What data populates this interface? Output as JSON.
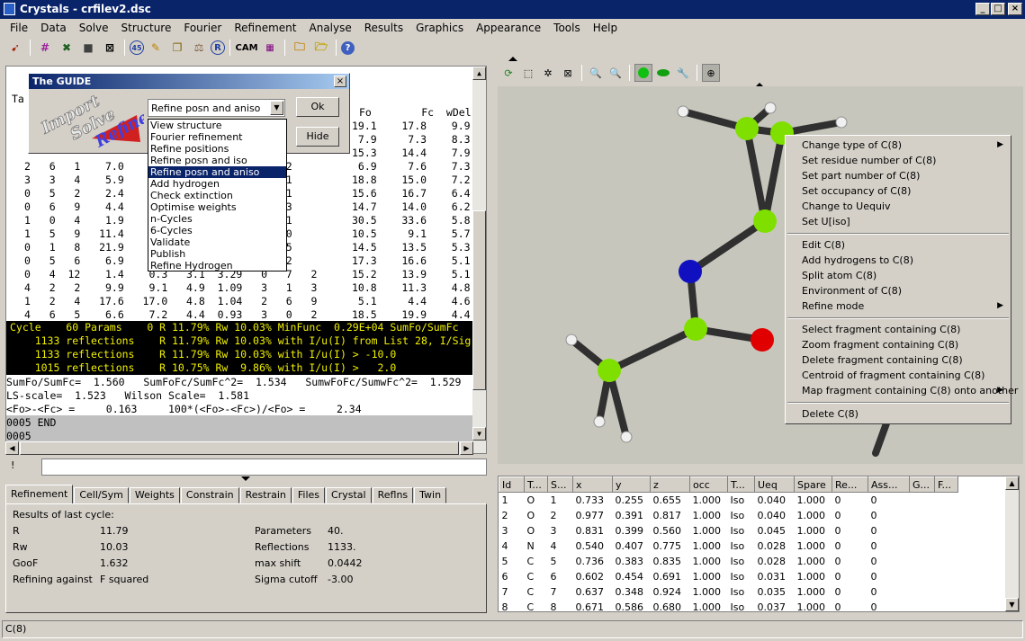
{
  "window": {
    "title": "Crystals - crfilev2.dsc"
  },
  "menu": [
    "File",
    "Data",
    "Solve",
    "Structure",
    "Fourier",
    "Refinement",
    "Analyse",
    "Results",
    "Graphics",
    "Appearance",
    "Tools",
    "Help"
  ],
  "toolbar": {
    "cam_label": "CAM",
    "r_label": "R",
    "n45_label": "45"
  },
  "output": {
    "partial_header": "Ta",
    "header_cols": "Fo        Fc  wDel  F",
    "rows_right": [
      "19.1    17.8    9.9",
      " 7.9     7.3    8.3",
      "15.3    14.4    7.9",
      " 6.9     7.6    7.3",
      "18.8    15.0    7.2",
      "15.6    16.7    6.4",
      "14.7    14.0    6.2",
      "30.5    33.6    5.8",
      "10.5     9.1    5.7",
      "14.5    13.5    5.3",
      "17.3    16.6    5.1",
      "15.2    13.9    5.1",
      "10.8    11.3    4.8",
      " 5.1     4.4    4.6",
      "18.5    19.9    4.4"
    ],
    "rows_full": [
      "2   6   1    7.0                      3  12",
      "3   3   4    5.9                      4   1",
      "0   5   2    2.4                      4   1",
      "0   6   9    4.4                      4   3",
      "1   0   4    1.9                      0   1",
      "1   5   9   11.4                      8   0",
      "0   1   8   21.9                      8   5",
      "0   5   6    6.9                      4   2",
      "0   4  12    1.4    0.3   3.1  3.29   0   7   2",
      "4   2   2    9.9    9.1   4.9  1.09   3   1   3",
      "1   2   4   17.6   17.0   4.8  1.04   2   6   9",
      "4   6   5    6.6    7.2   4.4  0.93   3   0   2"
    ],
    "cycle_lines": [
      "Cycle    60 Params    0 R 11.79% Rw 10.03% MinFunc  0.29E+04 SumFo/SumFc",
      "    1133 reflections    R 11.79% Rw 10.03% with I/u(I) from List 28, I/Sig",
      "    1133 reflections    R 11.79% Rw 10.03% with I/u(I) > -10.0",
      "    1015 reflections    R 10.75% Rw  9.86% with I/u(I) >   2.0"
    ],
    "summary_lines": [
      "SumFo/SumFc=  1.560   SumFoFc/SumFc^2=  1.534   SumwFoFc/SumwFc^2=  1.529",
      "LS-scale=  1.523   Wilson Scale=  1.581",
      "<Fo>-<Fc> =     0.163     100*(<Fo>-<Fc>)/<Fo> =     2.34"
    ],
    "end_lines": [
      "0005 END",
      "0005"
    ]
  },
  "cmd": {
    "prompt": "!"
  },
  "guide": {
    "title": "The GUIDE",
    "selected": "Refine posn and aniso",
    "ok_label": "Ok",
    "hide_label": "Hide",
    "logo_words": [
      "Import",
      "Solve",
      "Refine"
    ],
    "options": [
      "View structure",
      "Fourier refinement",
      "Refine positions",
      "Refine posn and iso",
      "Refine posn and aniso",
      "Add hydrogen",
      "Check extinction",
      "Optimise weights",
      "n-Cycles",
      "6-Cycles",
      "Validate",
      "Publish",
      "Refine Hydrogen"
    ]
  },
  "tabs": [
    "Refinement",
    "Cell/Sym",
    "Weights",
    "Constrain",
    "Restrain",
    "Files",
    "Crystal",
    "Reflns",
    "Twin"
  ],
  "results": {
    "heading": "Results of last cycle:",
    "left": [
      {
        "label": "R",
        "value": "11.79"
      },
      {
        "label": "Rw",
        "value": "10.03"
      },
      {
        "label": "GooF",
        "value": "1.632"
      },
      {
        "label": "Refining against",
        "value": "F squared"
      }
    ],
    "right": [
      {
        "label": "Parameters",
        "value": "40."
      },
      {
        "label": "Reflections",
        "value": "1133."
      },
      {
        "label": "max shift",
        "value": "0.0442"
      },
      {
        "label": "Sigma cutoff",
        "value": "-3.00"
      }
    ]
  },
  "context_menu": {
    "group1": [
      "Change type of C(8)",
      "Set residue number of C(8)",
      "Set part number of C(8)",
      "Set occupancy of C(8)",
      "Change to Uequiv",
      "Set U[iso]"
    ],
    "group2": [
      "Edit C(8)",
      "Add hydrogens to C(8)",
      "Split atom C(8)",
      "Environment of C(8)",
      "Refine mode"
    ],
    "group3": [
      "Select fragment containing C(8)",
      "Zoom fragment containing C(8)",
      "Delete fragment containing C(8)",
      "Centroid of fragment containing C(8)",
      "Map fragment containing C(8) onto another"
    ],
    "group4": [
      "Delete C(8)"
    ]
  },
  "atom_table": {
    "headers": [
      "Id",
      "T...",
      "S...",
      "x",
      "y",
      "z",
      "occ",
      "T...",
      "Ueq",
      "Spare",
      "Re...",
      "Ass...",
      "G...",
      "F..."
    ],
    "rows": [
      [
        "1",
        "O",
        "1",
        "0.733",
        "0.255",
        "0.655",
        "1.000",
        "Iso",
        "0.040",
        "1.000",
        "0",
        "0"
      ],
      [
        "2",
        "O",
        "2",
        "0.977",
        "0.391",
        "0.817",
        "1.000",
        "Iso",
        "0.040",
        "1.000",
        "0",
        "0"
      ],
      [
        "3",
        "O",
        "3",
        "0.831",
        "0.399",
        "0.560",
        "1.000",
        "Iso",
        "0.045",
        "1.000",
        "0",
        "0"
      ],
      [
        "4",
        "N",
        "4",
        "0.540",
        "0.407",
        "0.775",
        "1.000",
        "Iso",
        "0.028",
        "1.000",
        "0",
        "0"
      ],
      [
        "5",
        "C",
        "5",
        "0.736",
        "0.383",
        "0.835",
        "1.000",
        "Iso",
        "0.028",
        "1.000",
        "0",
        "0"
      ],
      [
        "6",
        "C",
        "6",
        "0.602",
        "0.454",
        "0.691",
        "1.000",
        "Iso",
        "0.031",
        "1.000",
        "0",
        "0"
      ],
      [
        "7",
        "C",
        "7",
        "0.637",
        "0.348",
        "0.924",
        "1.000",
        "Iso",
        "0.035",
        "1.000",
        "0",
        "0"
      ],
      [
        "8",
        "C",
        "8",
        "0.671",
        "0.586",
        "0.680",
        "1.000",
        "Iso",
        "0.037",
        "1.000",
        "0",
        "0"
      ]
    ]
  },
  "status": {
    "text": "C(8)"
  },
  "colors": {
    "title_bar": "#0a246a",
    "selection": "#0a246a",
    "carbon": "#7fe000",
    "nitrogen": "#1010c0",
    "oxygen": "#e00000",
    "hydrogen": "#f0f0f0",
    "bond": "#303030",
    "cycle_text": "#f0f000"
  }
}
